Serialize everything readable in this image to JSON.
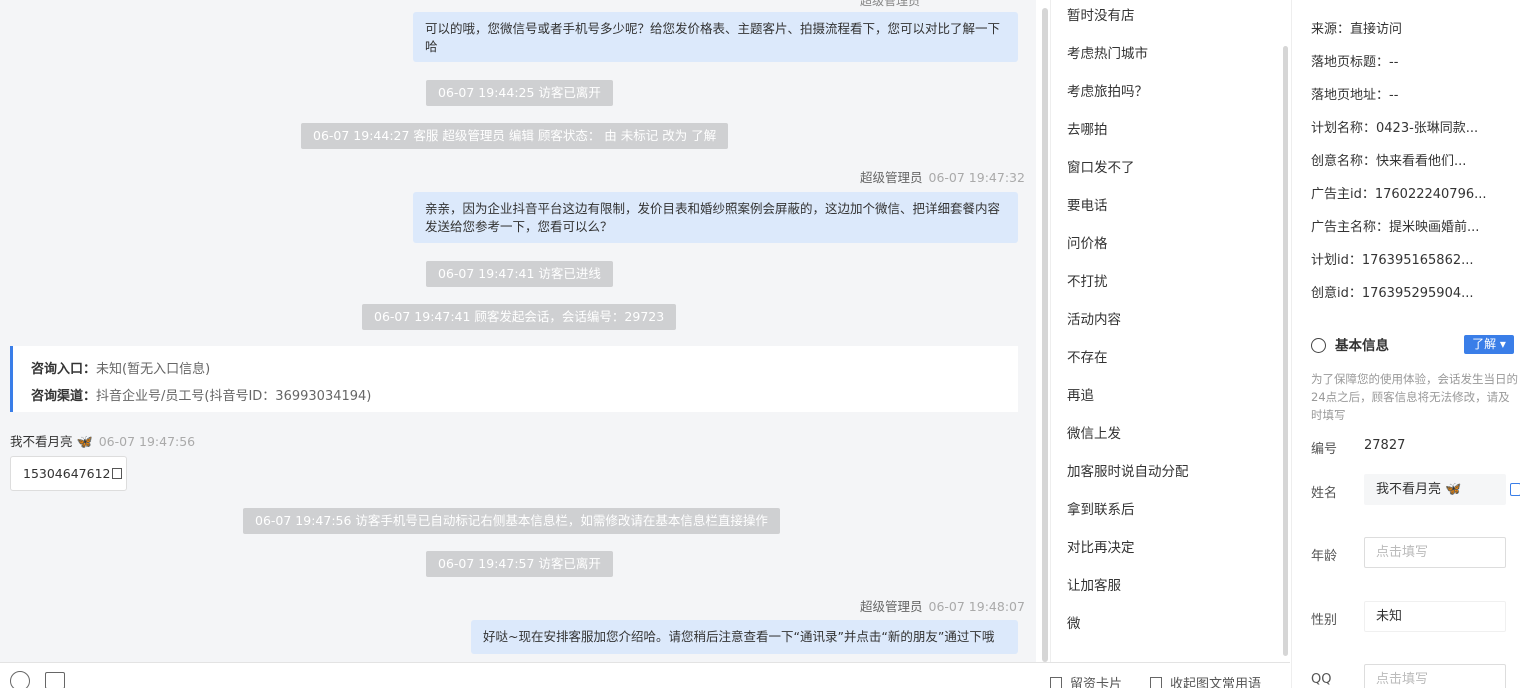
{
  "chat": {
    "top_cut_sender": "超级管理员",
    "msg1": "可以的哦，您微信号或者手机号多少呢？给您发价格表、主题客片、拍摄流程看下，您可以对比了解一下哈",
    "sys1": "06-07 19:44:25 访客已离开",
    "sys2": "06-07 19:44:27 客服 超级管理员 编辑 顾客状态： 由 未标记 改为 了解",
    "meta2_name": "超级管理员",
    "meta2_time": "06-07 19:47:32",
    "msg2": "亲亲，因为企业抖音平台这边有限制，发价目表和婚纱照案例会屏蔽的，这边加个微信、把详细套餐内容发送给您参考一下，您看可以么？",
    "sys3": "06-07 19:47:41 访客已进线",
    "sys4": "06-07 19:47:41 顾客发起会话，会话编号：29723",
    "entry_label": "咨询入口：",
    "entry_value": "未知(暂无入口信息)",
    "channel_label": "咨询渠道：",
    "channel_value": "抖音企业号/员工号(抖音号ID：36993034194)",
    "visitor_name": "我不看月亮",
    "visitor_time": "06-07 19:47:56",
    "visitor_phone": "15304647612",
    "sys5": "06-07 19:47:56 访客手机号已自动标记右侧基本信息栏，如需修改请在基本信息栏直接操作",
    "sys6": "06-07 19:47:57 访客已离开",
    "meta3_name": "超级管理员",
    "meta3_time": "06-07 19:48:07",
    "msg3": "好哒~现在安排客服加您介绍哈。请您稍后注意查看一下“通讯录”并点击“新的朋友”通过下哦"
  },
  "composer": {
    "leave_card": "留资卡片",
    "collapse": "收起图文常用语"
  },
  "quick_replies": [
    "暂时没有店",
    "考虑热门城市",
    "考虑旅拍吗？",
    "去哪拍",
    "窗口发不了",
    "要电话",
    "问价格",
    "不打扰",
    "活动内容",
    "不存在",
    "再追",
    "微信上发",
    "加客服时说自动分配",
    "拿到联系后",
    "对比再决定",
    "让加客服",
    "微"
  ],
  "panel": {
    "source": "来源：直接访问",
    "landing_title": "落地页标题：--",
    "landing_url": "落地页地址：--",
    "plan_name": "计划名称：0423-张琳同款...",
    "creative_name": "创意名称：快来看看他们...",
    "advertiser_id": "广告主id：176022240796...",
    "advertiser_name": "广告主名称：提米映画婚前...",
    "plan_id": "计划id：176395165862...",
    "creative_id": "创意id：176395295904...",
    "basic_title": "基本信息",
    "status_btn": "了解",
    "note": "为了保障您的使用体验，会话发生当日的24点之后，顾客信息将无法修改，请及时填写",
    "number_label": "编号",
    "number_value": "27827",
    "name_label": "姓名",
    "name_value": "我不看月亮",
    "age_label": "年龄",
    "age_placeholder": "点击填写",
    "gender_label": "性别",
    "gender_value": "未知",
    "qq_label": "QQ",
    "qq_placeholder": "点击填写"
  },
  "colors": {
    "accent": "#3a7ee8",
    "bubble": "#dce9fb",
    "system_pill": "#cfd0d2"
  }
}
